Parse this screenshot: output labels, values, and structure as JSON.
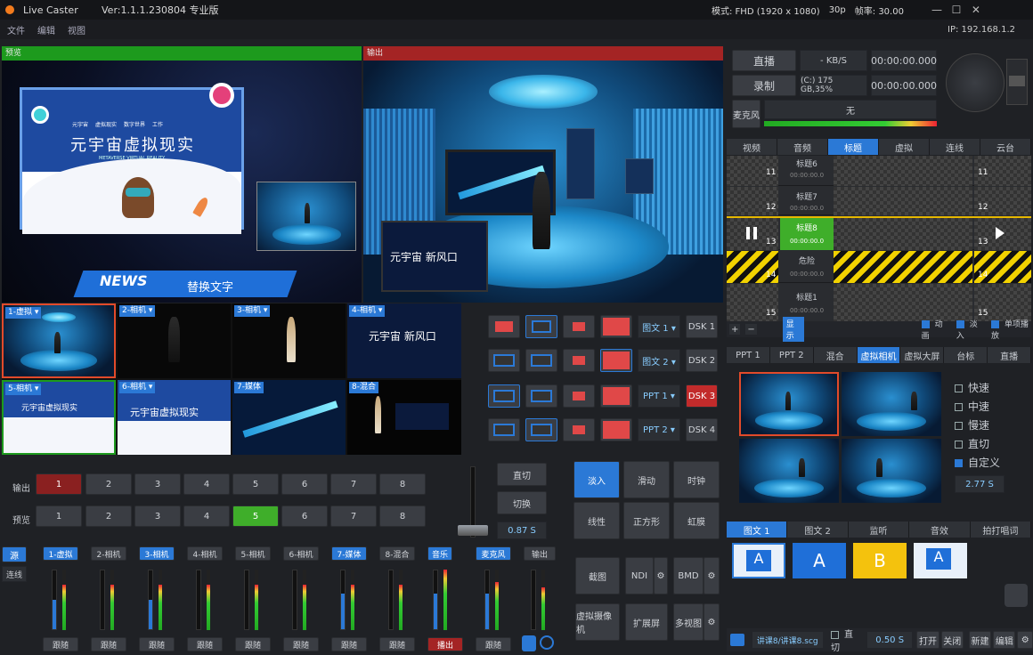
{
  "titlebar": {
    "app_name": "Live Caster",
    "version": "Ver:1.1.1.230804 专业版",
    "mode": "模式: FHD (1920 x 1080)",
    "fps": "30p",
    "frame_rate": "帧率: 30.00",
    "min": "—",
    "max": "☐",
    "close": "✕"
  },
  "menubar": {
    "file": "文件",
    "edit": "编辑",
    "view": "视图",
    "ip": "IP:   192.168.1.2"
  },
  "preview": {
    "label": "预览",
    "headline": "元宇宙虚拟现实",
    "subline": "METAVERSE VIRTUAL REALITY",
    "tabs": [
      "元宇宙",
      "虚拟现实",
      "数字世界",
      "工作"
    ],
    "news": "NEWS",
    "replace_text": "替换文字"
  },
  "output": {
    "label": "输出",
    "screen_text": "元宇宙 新风口"
  },
  "stream": {
    "live_btn": "直播",
    "kbs": "- KB/S",
    "live_time": "00:00:00.000",
    "record_btn": "录制",
    "disk": "(C:) 175 GB,35%",
    "record_time": "00:00:00.000",
    "mic_btn": "麦克风",
    "mic_value": "无"
  },
  "sources": [
    {
      "label": "1-虚拟 ▾"
    },
    {
      "label": "2-相机 ▾"
    },
    {
      "label": "3-相机 ▾"
    },
    {
      "label": "4-相机 ▾"
    },
    {
      "label": "5-相机 ▾"
    },
    {
      "label": "6-相机 ▾"
    },
    {
      "label": "7-媒体"
    },
    {
      "label": "8-混合"
    }
  ],
  "source_texts": {
    "s4": "元宇宙 新风口",
    "s5": "元宇宙虚拟现实",
    "s6": "元宇宙虚拟现实"
  },
  "dsk": {
    "rows": [
      {
        "select": "图文 1 ▾",
        "btn": "DSK 1"
      },
      {
        "select": "图文 2 ▾",
        "btn": "DSK 2"
      },
      {
        "select": "PPT 1 ▾",
        "btn": "DSK 3"
      },
      {
        "select": "PPT 2 ▾",
        "btn": "DSK 4"
      }
    ]
  },
  "switcher": {
    "out_label": "输出",
    "pv_label": "预览",
    "numbers": [
      "1",
      "2",
      "3",
      "4",
      "5",
      "6",
      "7",
      "8"
    ],
    "cut": "直切",
    "switch": "切换",
    "duration": "0.87 S"
  },
  "transitions": [
    "淡入",
    "滑动",
    "时钟",
    "线性",
    "正方形",
    "虹膜"
  ],
  "tools": {
    "screenshot": "截图",
    "ndi": "NDI",
    "bmd": "BMD",
    "vcam": "虚拟摄像机",
    "extend": "扩展屏",
    "multiview": "多视图",
    "gear": "⚙"
  },
  "mixer": {
    "mode_src": "源",
    "mode_link": "连线",
    "channels": [
      "1-虚拟",
      "2-相机",
      "3-相机",
      "4-相机",
      "5-相机",
      "6-相机",
      "7-媒体",
      "8-混合",
      "音乐",
      "麦克风",
      "输出"
    ],
    "follow": "跟随",
    "play": "播出"
  },
  "right_tabs": [
    "视频",
    "音频",
    "标题",
    "虚拟",
    "连线",
    "云台"
  ],
  "titles": {
    "rows": [
      {
        "name": "标题6",
        "time": "00:00:00.0",
        "num_l": "11",
        "num_r": "11"
      },
      {
        "name": "标题7",
        "time": "00:00:00.0",
        "num_l": "12",
        "num_r": "12"
      },
      {
        "name": "标题8",
        "time": "00:00:00.0",
        "num_l": "13",
        "num_r": "13"
      },
      {
        "name": "危险",
        "time": "00:00:00.0",
        "num_l": "14",
        "num_r": "14"
      },
      {
        "name": "标题1",
        "time": "00:00:00.0",
        "num_l": "15",
        "num_r": "15"
      }
    ],
    "add": "+",
    "remove": "−",
    "show": "显示",
    "anim": "动画",
    "fade": "淡入",
    "single": "单项播放"
  },
  "scene_tabs": [
    "PPT 1",
    "PPT 2",
    "混合",
    "虚拟相机",
    "虚拟大屏",
    "台标",
    "直播"
  ],
  "speed": {
    "options": [
      "快速",
      "中速",
      "慢速",
      "直切",
      "自定义"
    ],
    "value": "2.77 S"
  },
  "bottom_tabs": [
    "图文 1",
    "图文 2",
    "监听",
    "音效",
    "拍打唱词"
  ],
  "gallery": [
    "A",
    "A",
    "B",
    "A"
  ],
  "footer": {
    "file": "讲课8/讲课8.scg",
    "cut": "直切",
    "dur": "0.50 S",
    "open": "打开",
    "close": "关闭",
    "new": "新建",
    "edit": "编辑"
  },
  "colors": {
    "accent": "#2b79d6",
    "preview_bar": "#1d9a1d",
    "output_bar": "#a42424",
    "active_green": "#3fae2a",
    "dsk_red": "#c22b2b"
  }
}
